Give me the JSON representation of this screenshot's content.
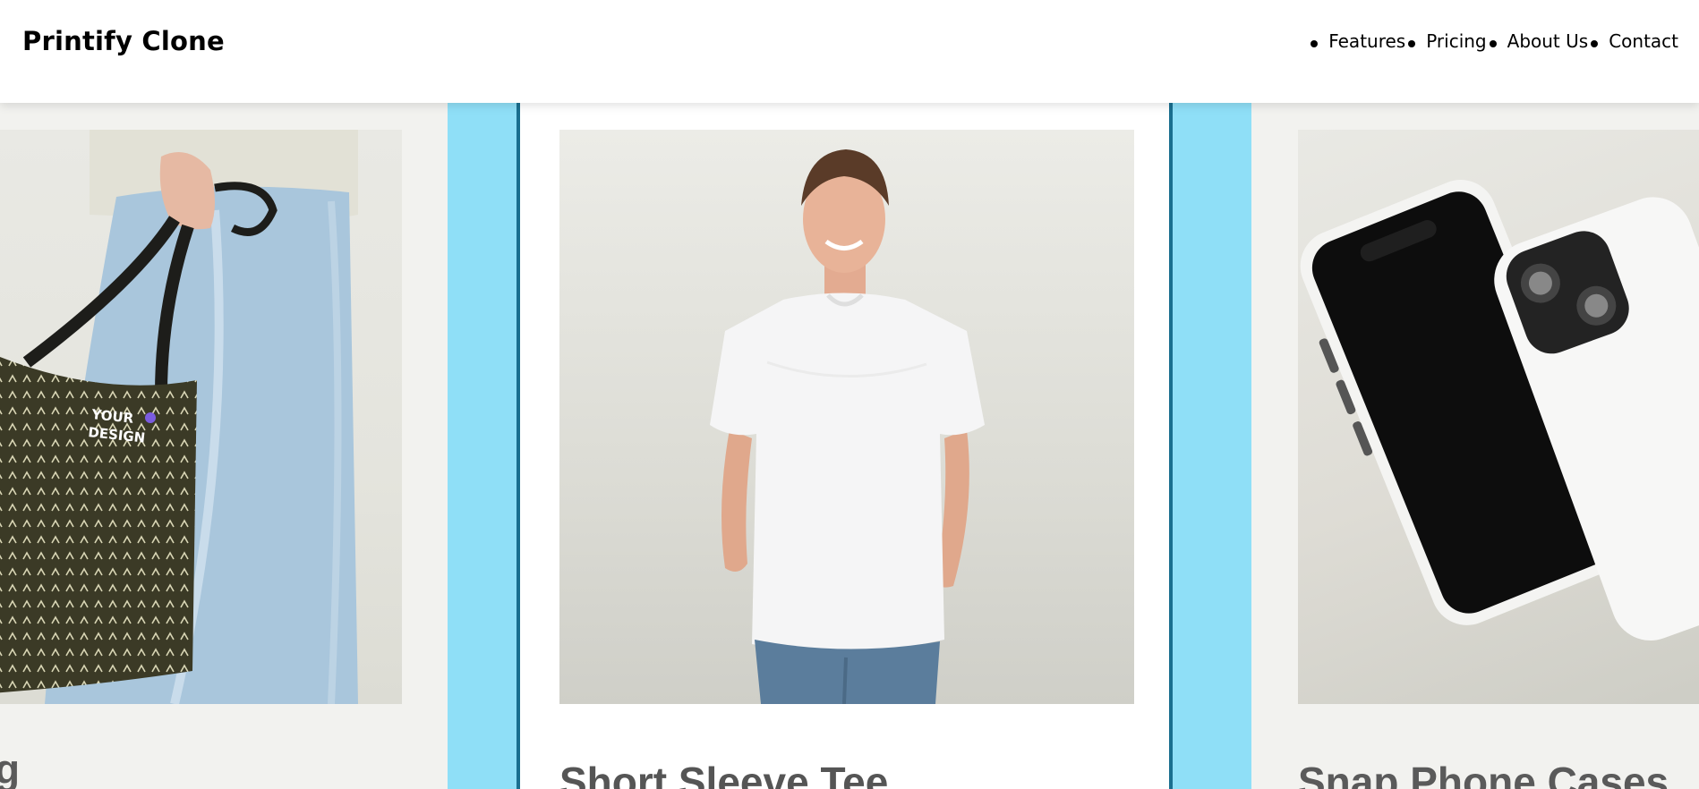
{
  "header": {
    "brand": "Printify Clone",
    "nav": [
      {
        "label": "Features"
      },
      {
        "label": "Pricing"
      },
      {
        "label": "About Us"
      },
      {
        "label": "Contact"
      }
    ]
  },
  "carousel": {
    "cards": [
      {
        "title": "g",
        "image": "tote-bag-product-photo",
        "print_text": "YOUR DESIGN"
      },
      {
        "title": "Short Sleeve Tee",
        "image": "white-tshirt-model-photo"
      },
      {
        "title": "Snap Phone Cases",
        "image": "phone-case-product-photo"
      }
    ]
  },
  "colors": {
    "accent": "#8fdff7",
    "card_border": "#1a6f8f",
    "text": "#000000"
  }
}
